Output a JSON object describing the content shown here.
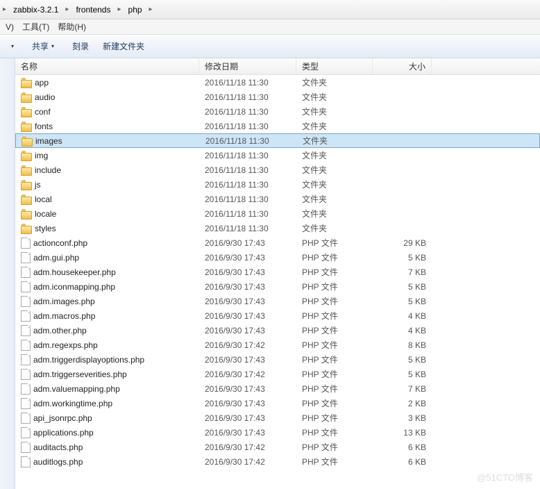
{
  "breadcrumb": {
    "items": [
      "zabbix-3.2.1",
      "frontends",
      "php"
    ]
  },
  "menubar": {
    "items": [
      {
        "label": "V)",
        "key": "v"
      },
      {
        "label": "工具(T)",
        "key": "tools"
      },
      {
        "label": "帮助(H)",
        "key": "help"
      }
    ]
  },
  "toolbar": {
    "share": "共享",
    "burn": "刻录",
    "new_folder": "新建文件夹"
  },
  "columns": {
    "name": "名称",
    "date": "修改日期",
    "type": "类型",
    "size": "大小"
  },
  "files": [
    {
      "name": "app",
      "date": "2016/11/18 11:30",
      "type": "文件夹",
      "size": "",
      "icon": "folder",
      "selected": false
    },
    {
      "name": "audio",
      "date": "2016/11/18 11:30",
      "type": "文件夹",
      "size": "",
      "icon": "folder",
      "selected": false
    },
    {
      "name": "conf",
      "date": "2016/11/18 11:30",
      "type": "文件夹",
      "size": "",
      "icon": "folder",
      "selected": false
    },
    {
      "name": "fonts",
      "date": "2016/11/18 11:30",
      "type": "文件夹",
      "size": "",
      "icon": "folder",
      "selected": false
    },
    {
      "name": "images",
      "date": "2016/11/18 11:30",
      "type": "文件夹",
      "size": "",
      "icon": "folder",
      "selected": true
    },
    {
      "name": "img",
      "date": "2016/11/18 11:30",
      "type": "文件夹",
      "size": "",
      "icon": "folder",
      "selected": false
    },
    {
      "name": "include",
      "date": "2016/11/18 11:30",
      "type": "文件夹",
      "size": "",
      "icon": "folder",
      "selected": false
    },
    {
      "name": "js",
      "date": "2016/11/18 11:30",
      "type": "文件夹",
      "size": "",
      "icon": "folder",
      "selected": false
    },
    {
      "name": "local",
      "date": "2016/11/18 11:30",
      "type": "文件夹",
      "size": "",
      "icon": "folder",
      "selected": false
    },
    {
      "name": "locale",
      "date": "2016/11/18 11:30",
      "type": "文件夹",
      "size": "",
      "icon": "folder",
      "selected": false
    },
    {
      "name": "styles",
      "date": "2016/11/18 11:30",
      "type": "文件夹",
      "size": "",
      "icon": "folder",
      "selected": false
    },
    {
      "name": "actionconf.php",
      "date": "2016/9/30 17:43",
      "type": "PHP 文件",
      "size": "29 KB",
      "icon": "file",
      "selected": false
    },
    {
      "name": "adm.gui.php",
      "date": "2016/9/30 17:43",
      "type": "PHP 文件",
      "size": "5 KB",
      "icon": "file",
      "selected": false
    },
    {
      "name": "adm.housekeeper.php",
      "date": "2016/9/30 17:43",
      "type": "PHP 文件",
      "size": "7 KB",
      "icon": "file",
      "selected": false
    },
    {
      "name": "adm.iconmapping.php",
      "date": "2016/9/30 17:43",
      "type": "PHP 文件",
      "size": "5 KB",
      "icon": "file",
      "selected": false
    },
    {
      "name": "adm.images.php",
      "date": "2016/9/30 17:43",
      "type": "PHP 文件",
      "size": "5 KB",
      "icon": "file",
      "selected": false
    },
    {
      "name": "adm.macros.php",
      "date": "2016/9/30 17:43",
      "type": "PHP 文件",
      "size": "4 KB",
      "icon": "file",
      "selected": false
    },
    {
      "name": "adm.other.php",
      "date": "2016/9/30 17:43",
      "type": "PHP 文件",
      "size": "4 KB",
      "icon": "file",
      "selected": false
    },
    {
      "name": "adm.regexps.php",
      "date": "2016/9/30 17:42",
      "type": "PHP 文件",
      "size": "8 KB",
      "icon": "file",
      "selected": false
    },
    {
      "name": "adm.triggerdisplayoptions.php",
      "date": "2016/9/30 17:43",
      "type": "PHP 文件",
      "size": "5 KB",
      "icon": "file",
      "selected": false
    },
    {
      "name": "adm.triggerseverities.php",
      "date": "2016/9/30 17:42",
      "type": "PHP 文件",
      "size": "5 KB",
      "icon": "file",
      "selected": false
    },
    {
      "name": "adm.valuemapping.php",
      "date": "2016/9/30 17:43",
      "type": "PHP 文件",
      "size": "7 KB",
      "icon": "file",
      "selected": false
    },
    {
      "name": "adm.workingtime.php",
      "date": "2016/9/30 17:43",
      "type": "PHP 文件",
      "size": "2 KB",
      "icon": "file",
      "selected": false
    },
    {
      "name": "api_jsonrpc.php",
      "date": "2016/9/30 17:43",
      "type": "PHP 文件",
      "size": "3 KB",
      "icon": "file",
      "selected": false
    },
    {
      "name": "applications.php",
      "date": "2016/9/30 17:43",
      "type": "PHP 文件",
      "size": "13 KB",
      "icon": "file",
      "selected": false
    },
    {
      "name": "auditacts.php",
      "date": "2016/9/30 17:42",
      "type": "PHP 文件",
      "size": "6 KB",
      "icon": "file",
      "selected": false
    },
    {
      "name": "auditlogs.php",
      "date": "2016/9/30 17:42",
      "type": "PHP 文件",
      "size": "6 KB",
      "icon": "file",
      "selected": false
    }
  ],
  "watermark": "@51CTO博客"
}
